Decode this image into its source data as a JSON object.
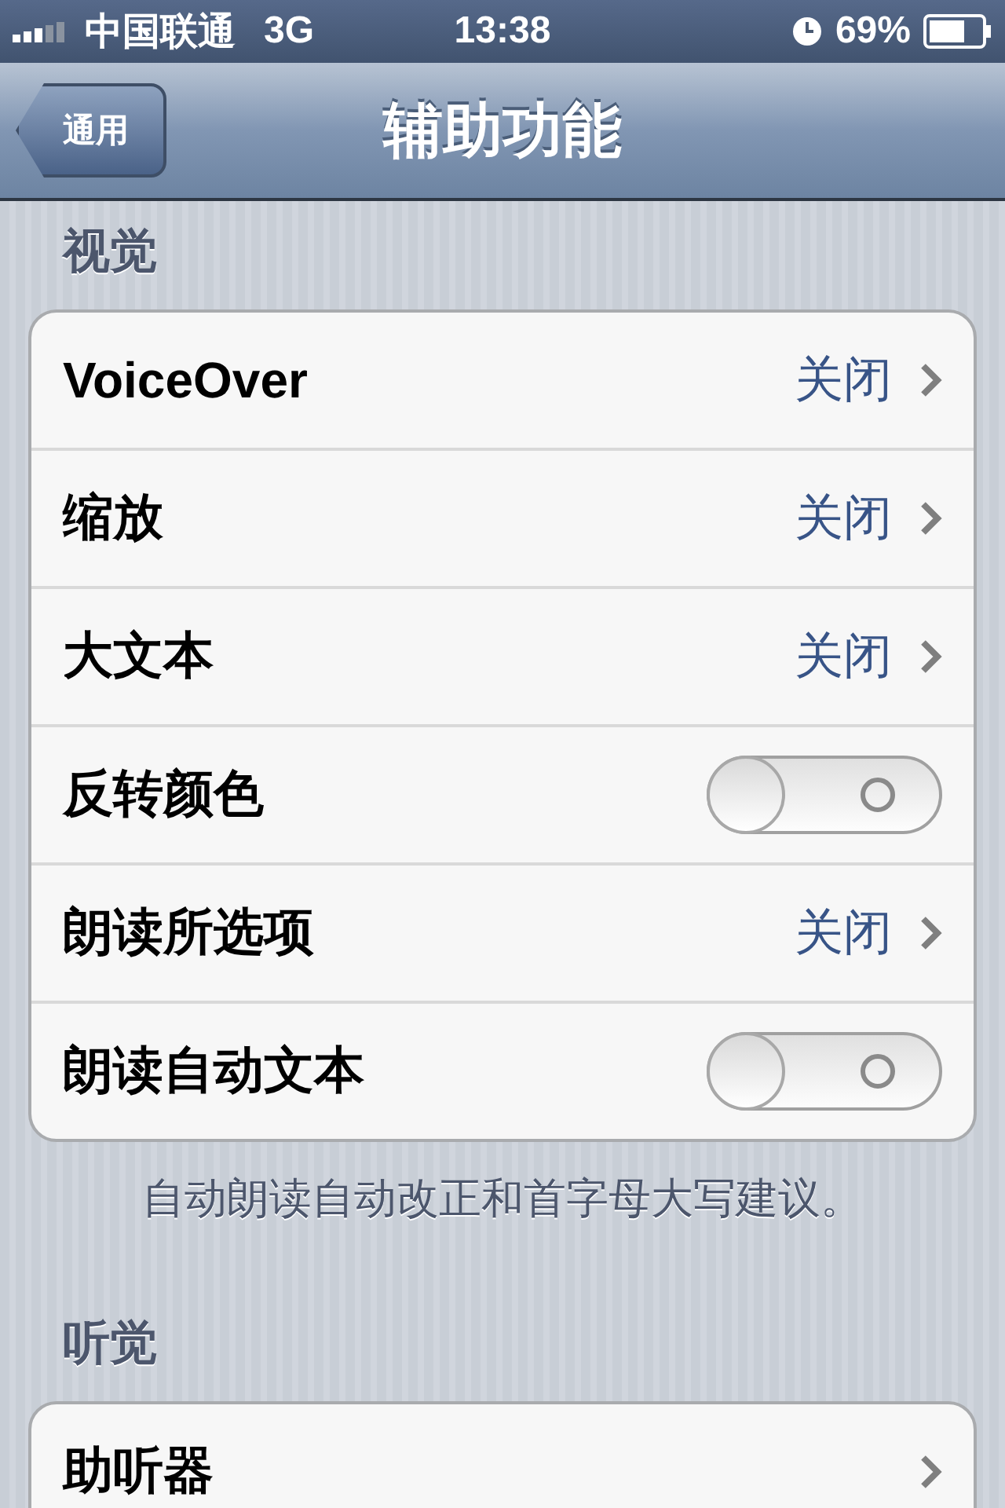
{
  "status_bar": {
    "carrier": "中国联通",
    "network": "3G",
    "time": "13:38",
    "battery": "69%"
  },
  "nav_bar": {
    "back": "通用",
    "title": "辅助功能"
  },
  "sections": [
    {
      "header": "视觉",
      "rows": [
        {
          "kind": "disclosure",
          "label": "VoiceOver",
          "value": "关闭"
        },
        {
          "kind": "disclosure",
          "label": "缩放",
          "value": "关闭"
        },
        {
          "kind": "disclosure",
          "label": "大文本",
          "value": "关闭"
        },
        {
          "kind": "switch",
          "label": "反转颜色",
          "on": false
        },
        {
          "kind": "disclosure",
          "label": "朗读所选项",
          "value": "关闭"
        },
        {
          "kind": "switch",
          "label": "朗读自动文本",
          "on": false
        }
      ],
      "footer": "自动朗读自动改正和首字母大写建议。"
    },
    {
      "header": "听觉",
      "rows": [
        {
          "kind": "disclosure",
          "label": "助听器"
        }
      ]
    }
  ]
}
